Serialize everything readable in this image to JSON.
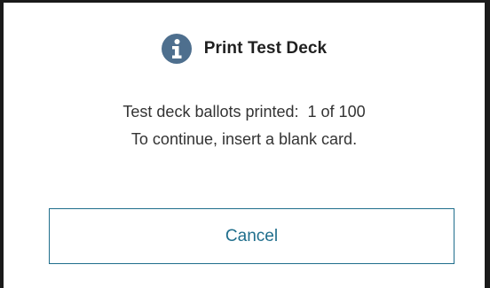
{
  "dialog": {
    "icon": "info-circle-icon",
    "title": "Print Test Deck",
    "message_line1_prefix": "Test deck ballots printed:",
    "printed_count": "1 of 100",
    "message_line2": "To continue, insert a blank card.",
    "cancel_label": "Cancel"
  },
  "colors": {
    "icon": "#4e6f8e",
    "accent": "#1f6e8c",
    "text": "#333333",
    "frame": "#1a1a1a"
  }
}
